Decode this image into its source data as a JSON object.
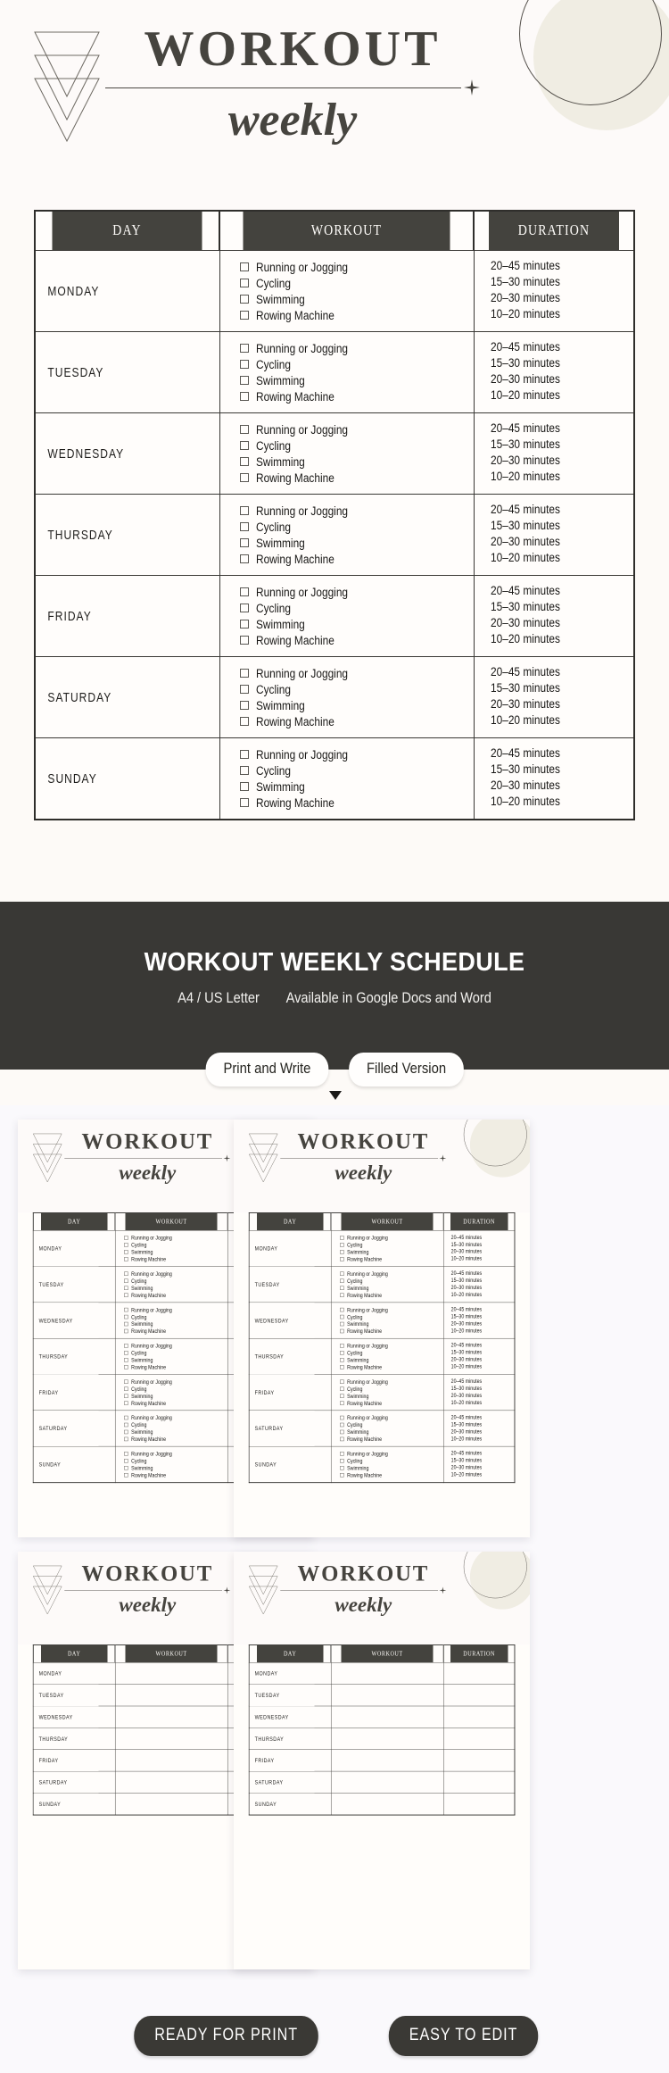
{
  "header": {
    "title_main": "WORKOUT",
    "title_sub": "weekly",
    "icons": {
      "triangles": "triangle-stack-icon",
      "sparkle": "sparkle-icon",
      "circle": "circle-decoration"
    }
  },
  "table": {
    "columns": [
      "DAY",
      "WORKOUT",
      "DURATION"
    ],
    "workouts": [
      "Running or Jogging",
      "Cycling",
      "Swimming",
      "Rowing Machine"
    ],
    "durations": [
      "20–45 minutes",
      "15–30 minutes",
      "20–30 minutes",
      "10–20 minutes"
    ],
    "days": [
      "MONDAY",
      "TUESDAY",
      "WEDNESDAY",
      "THURSDAY",
      "FRIDAY",
      "SATURDAY",
      "SUNDAY"
    ]
  },
  "banner": {
    "title": "WORKOUT WEEKLY SCHEDULE",
    "format": "A4 / US Letter",
    "availability": "Available in Google Docs and Word"
  },
  "tabs": [
    {
      "label": "Print and Write"
    },
    {
      "label": "Filled Version"
    }
  ],
  "previews": [
    {
      "name": "print-and-write-page-1",
      "filled": true
    },
    {
      "name": "print-and-write-page-2",
      "filled": true
    },
    {
      "name": "blank-template-page-1",
      "filled": false
    },
    {
      "name": "blank-template-page-2",
      "filled": false
    }
  ],
  "footer": {
    "buttons": [
      "READY FOR PRINT",
      "EASY TO EDIT"
    ]
  },
  "colors": {
    "page_bg": "#fdfaf7",
    "preview_bg": "#faf9fc",
    "dark": "#393835",
    "header_dark": "#44433e",
    "beige": "#f0ede3",
    "text": "#181715"
  }
}
